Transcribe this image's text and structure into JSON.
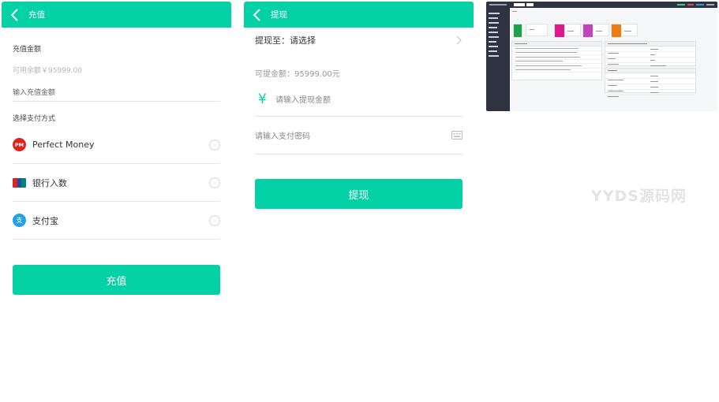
{
  "recharge": {
    "title": "充值",
    "amount_label": "充值金额",
    "balance_text": "可用余额￥95999.00",
    "amount_placeholder": "输入充值金额",
    "method_label": "选择支付方式",
    "methods": [
      {
        "name": "Perfect Money",
        "icon": "perfect-money-icon",
        "badge": "PM"
      },
      {
        "name": "银行入数",
        "icon": "unionpay-icon",
        "badge": "银联"
      },
      {
        "name": "支付宝",
        "icon": "alipay-icon",
        "badge": "支"
      }
    ],
    "submit_label": "充值"
  },
  "withdraw": {
    "title": "提现",
    "to_label": "提现至：请选择",
    "available": "可提金额：95999.00元",
    "amount_placeholder": "请输入提现金额",
    "currency_symbol": "¥",
    "password_placeholder": "请输入支付密码",
    "submit_label": "提现"
  },
  "watermark": "YYDS源码网",
  "colors": {
    "accent": "#05d1a6",
    "admin_dark": "#2f3341",
    "tile_colors": [
      "#1aa34a",
      "#e0198a",
      "#c145b8",
      "#f07b12"
    ]
  }
}
